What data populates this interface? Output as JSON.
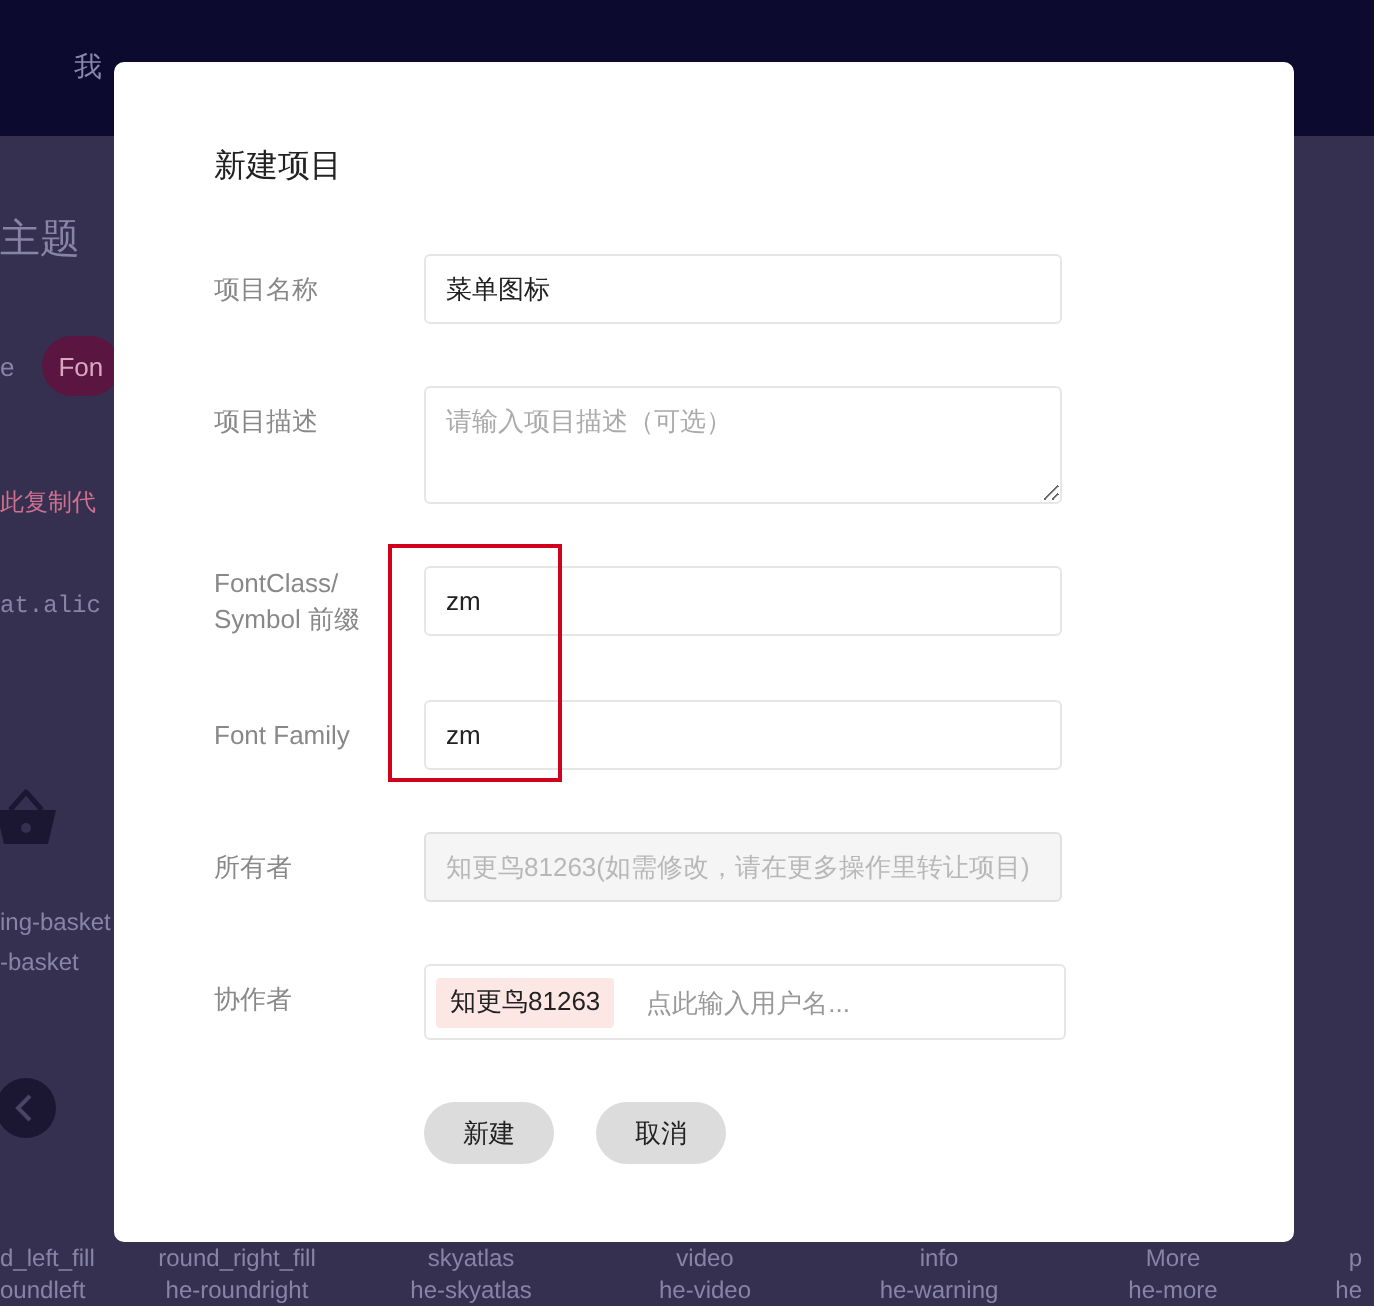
{
  "background": {
    "nav": [
      "我"
    ],
    "heading": "主题",
    "tabs": [
      {
        "label": "e",
        "selected": false
      },
      {
        "label": "Fon",
        "selected": true
      }
    ],
    "copy_hint": "此复制代",
    "code_url": "at.alic",
    "icon_names": [
      "ing-basket",
      "-basket"
    ],
    "icon_grid": [
      {
        "name": "d_left_fill",
        "code": "oundleft"
      },
      {
        "name": "round_right_fill",
        "code": "he-roundright"
      },
      {
        "name": "skyatlas",
        "code": "he-skyatlas"
      },
      {
        "name": "video",
        "code": "he-video"
      },
      {
        "name": "info",
        "code": "he-warning"
      },
      {
        "name": "More",
        "code": "he-more"
      },
      {
        "name": "p",
        "code": "he"
      }
    ]
  },
  "dialog": {
    "title": "新建项目",
    "fields": [
      {
        "kind": "text",
        "label": "项目名称",
        "value": "菜单图标",
        "disabled": false
      },
      {
        "kind": "textarea",
        "label": "项目描述",
        "placeholder": "请输入项目描述（可选）"
      },
      {
        "kind": "text",
        "label": "FontClass/\nSymbol 前缀",
        "value": "zm",
        "disabled": false
      },
      {
        "kind": "text",
        "label": "Font Family",
        "value": "zm",
        "disabled": false
      },
      {
        "kind": "text",
        "label": "所有者",
        "placeholder": "知更鸟81263(如需修改，请在更多操作里转让项目)",
        "disabled": true
      },
      {
        "kind": "tags",
        "label": "协作者",
        "tags": [
          "知更鸟81263"
        ],
        "placeholder": "点此输入用户名..."
      }
    ],
    "buttons": [
      "新建",
      "取消"
    ],
    "highlight": true
  }
}
